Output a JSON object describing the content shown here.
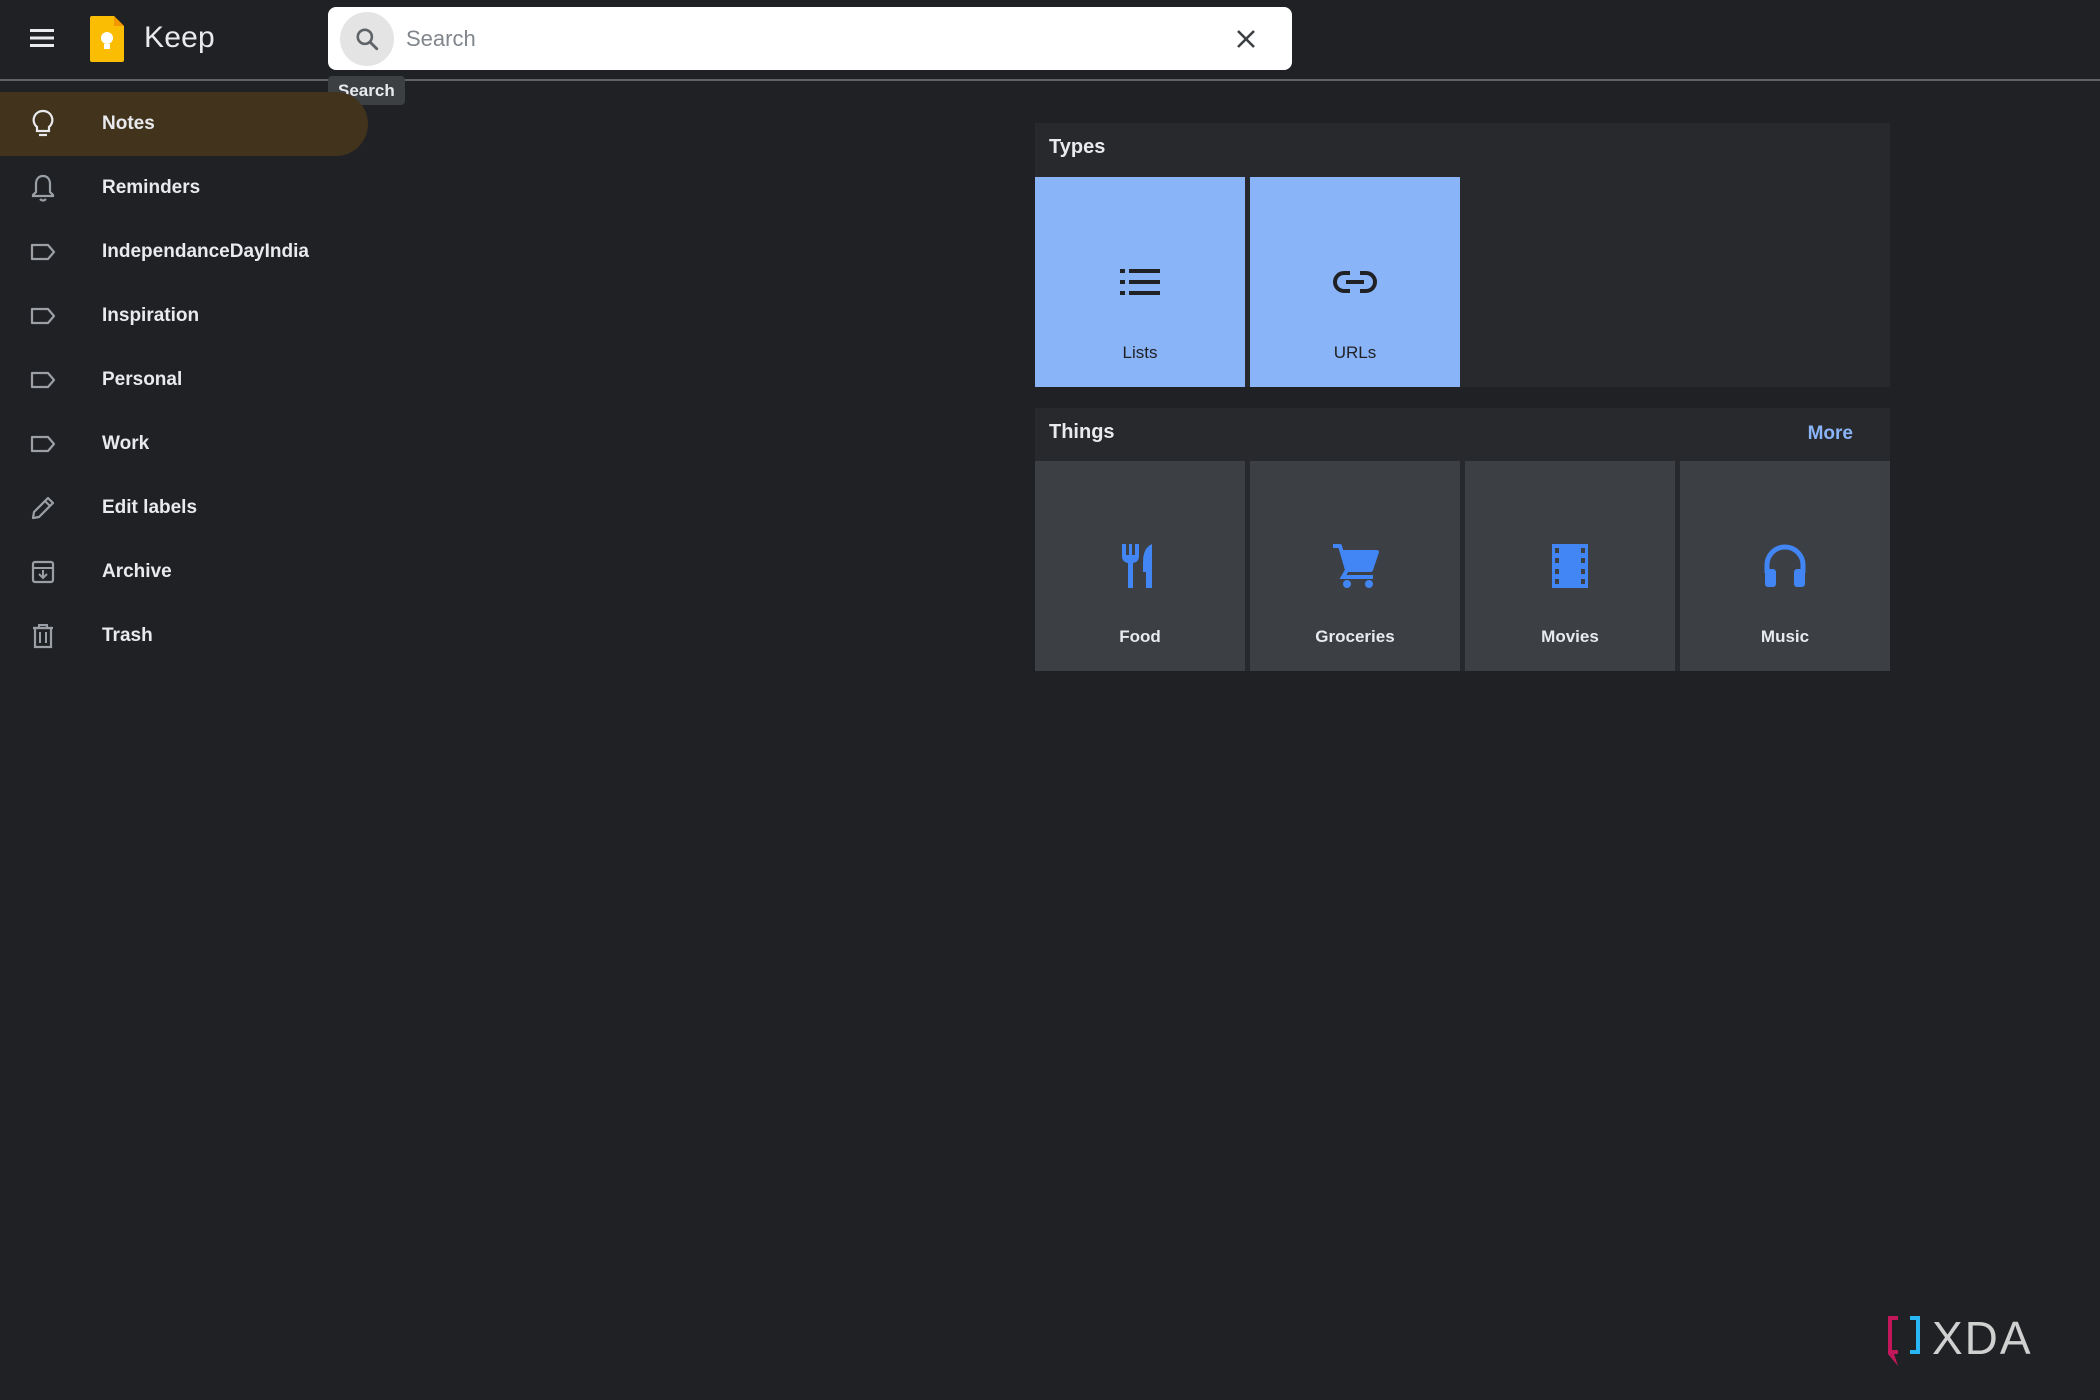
{
  "app": {
    "title": "Keep",
    "colors": {
      "background": "#202124",
      "accent": "#fbbc04",
      "active_nav": "#41331c",
      "type_tile": "#8ab4f8",
      "thing_icon": "#4285f4",
      "link": "#8ab4f8"
    }
  },
  "header": {
    "menu_icon": "hamburger-menu-icon",
    "logo_icon": "keep-bulb-logo",
    "search": {
      "placeholder": "Search",
      "value": "",
      "tooltip": "Search"
    }
  },
  "sidebar": {
    "items": [
      {
        "label": "Notes",
        "icon": "lightbulb-icon",
        "active": true
      },
      {
        "label": "Reminders",
        "icon": "bell-icon",
        "active": false
      },
      {
        "label": "IndependanceDayIndia",
        "icon": "label-icon",
        "active": false
      },
      {
        "label": "Inspiration",
        "icon": "label-icon",
        "active": false
      },
      {
        "label": "Personal",
        "icon": "label-icon",
        "active": false
      },
      {
        "label": "Work",
        "icon": "label-icon",
        "active": false
      },
      {
        "label": "Edit labels",
        "icon": "pencil-icon",
        "active": false
      },
      {
        "label": "Archive",
        "icon": "archive-icon",
        "active": false
      },
      {
        "label": "Trash",
        "icon": "trash-icon",
        "active": false
      }
    ]
  },
  "types": {
    "title": "Types",
    "tiles": [
      {
        "label": "Lists",
        "icon": "list-icon"
      },
      {
        "label": "URLs",
        "icon": "link-icon"
      }
    ]
  },
  "things": {
    "title": "Things",
    "more": "More",
    "tiles": [
      {
        "label": "Food",
        "icon": "restaurant-icon"
      },
      {
        "label": "Groceries",
        "icon": "shopping-cart-icon"
      },
      {
        "label": "Movies",
        "icon": "film-icon"
      },
      {
        "label": "Music",
        "icon": "headphones-icon"
      }
    ]
  },
  "watermark": {
    "text": "XDA"
  }
}
